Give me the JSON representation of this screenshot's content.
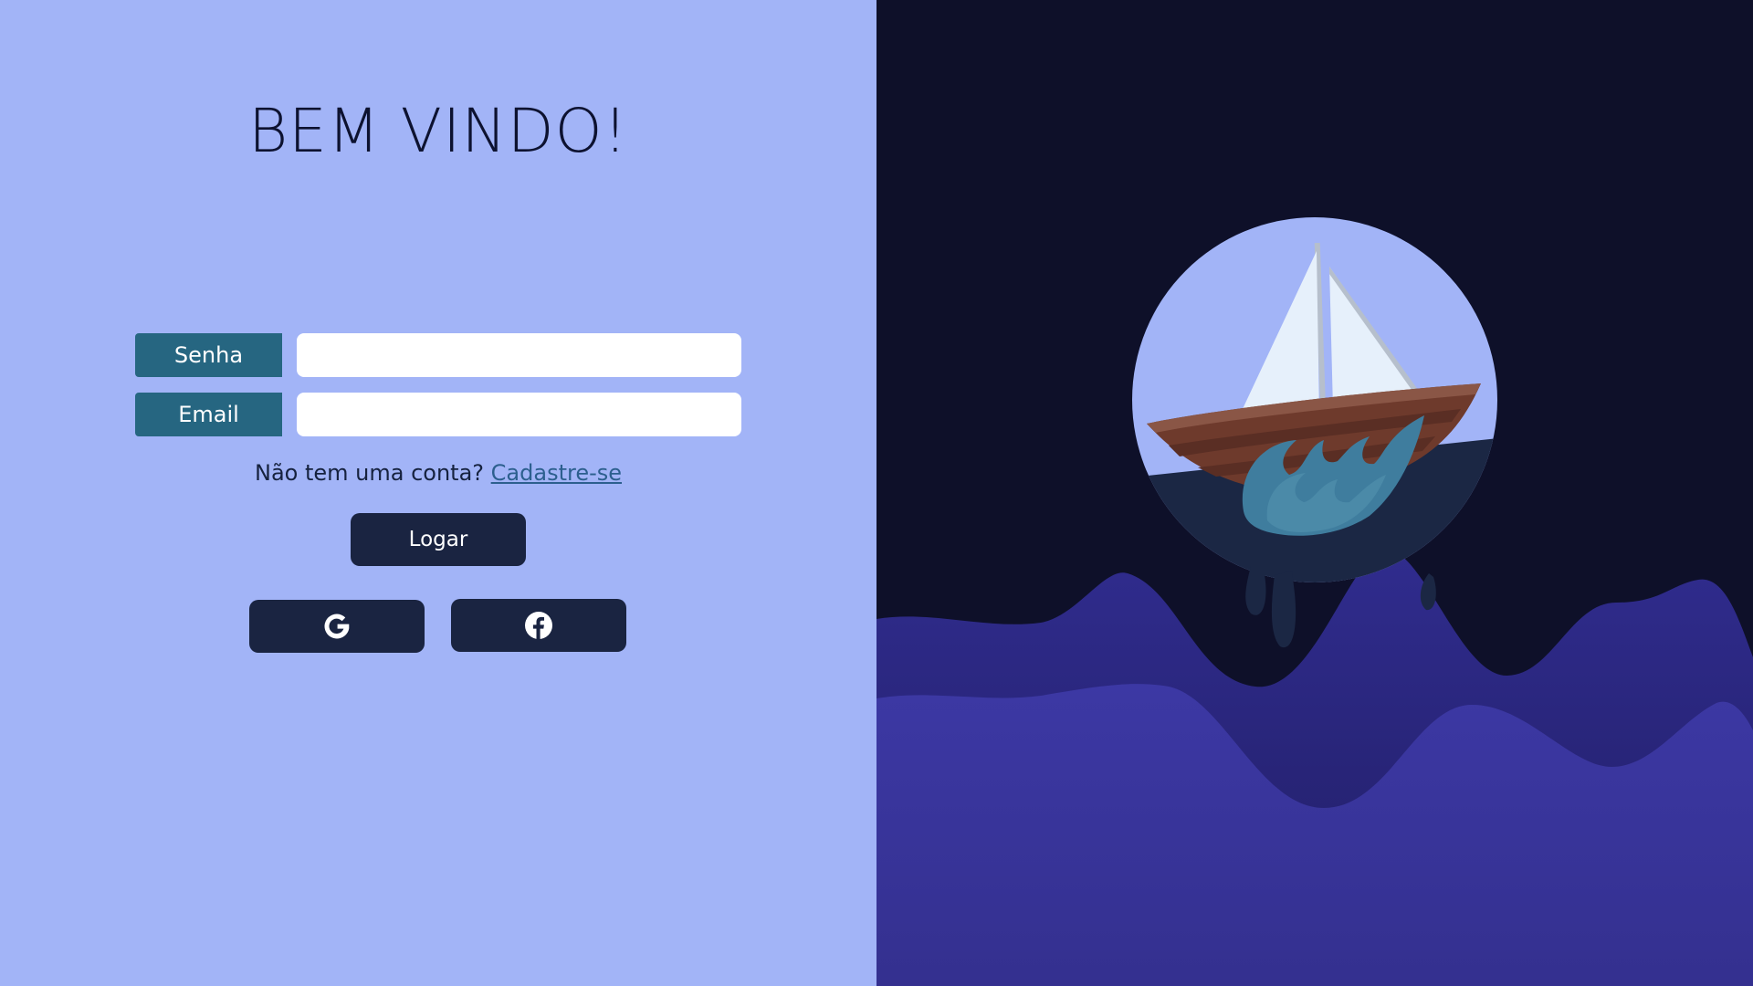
{
  "welcome": {
    "title": "BEM VINDO!"
  },
  "form": {
    "password_label": "Senha",
    "password_value": "",
    "email_label": "Email",
    "email_value": ""
  },
  "signup": {
    "prompt": "Não tem uma conta?",
    "link": "Cadastre-se"
  },
  "buttons": {
    "login_label": "Logar",
    "google_icon": "google-icon",
    "facebook_icon": "facebook-icon"
  },
  "illustration": {
    "subject": "sailboat-on-waves",
    "colors": {
      "night_sky": "#0e1029",
      "wave_front": "#3c38a4",
      "wave_back": "#2d2a85",
      "hull": "#6e3a2c",
      "sail": "#e6f0fb",
      "splash": "#3f7d9e",
      "circle_sky": "#a2b4f7",
      "circle_sea": "#1b2744"
    }
  },
  "theme": {
    "left_background": "#a2b4f7",
    "label_background": "#266681",
    "button_background": "#1a2441"
  }
}
